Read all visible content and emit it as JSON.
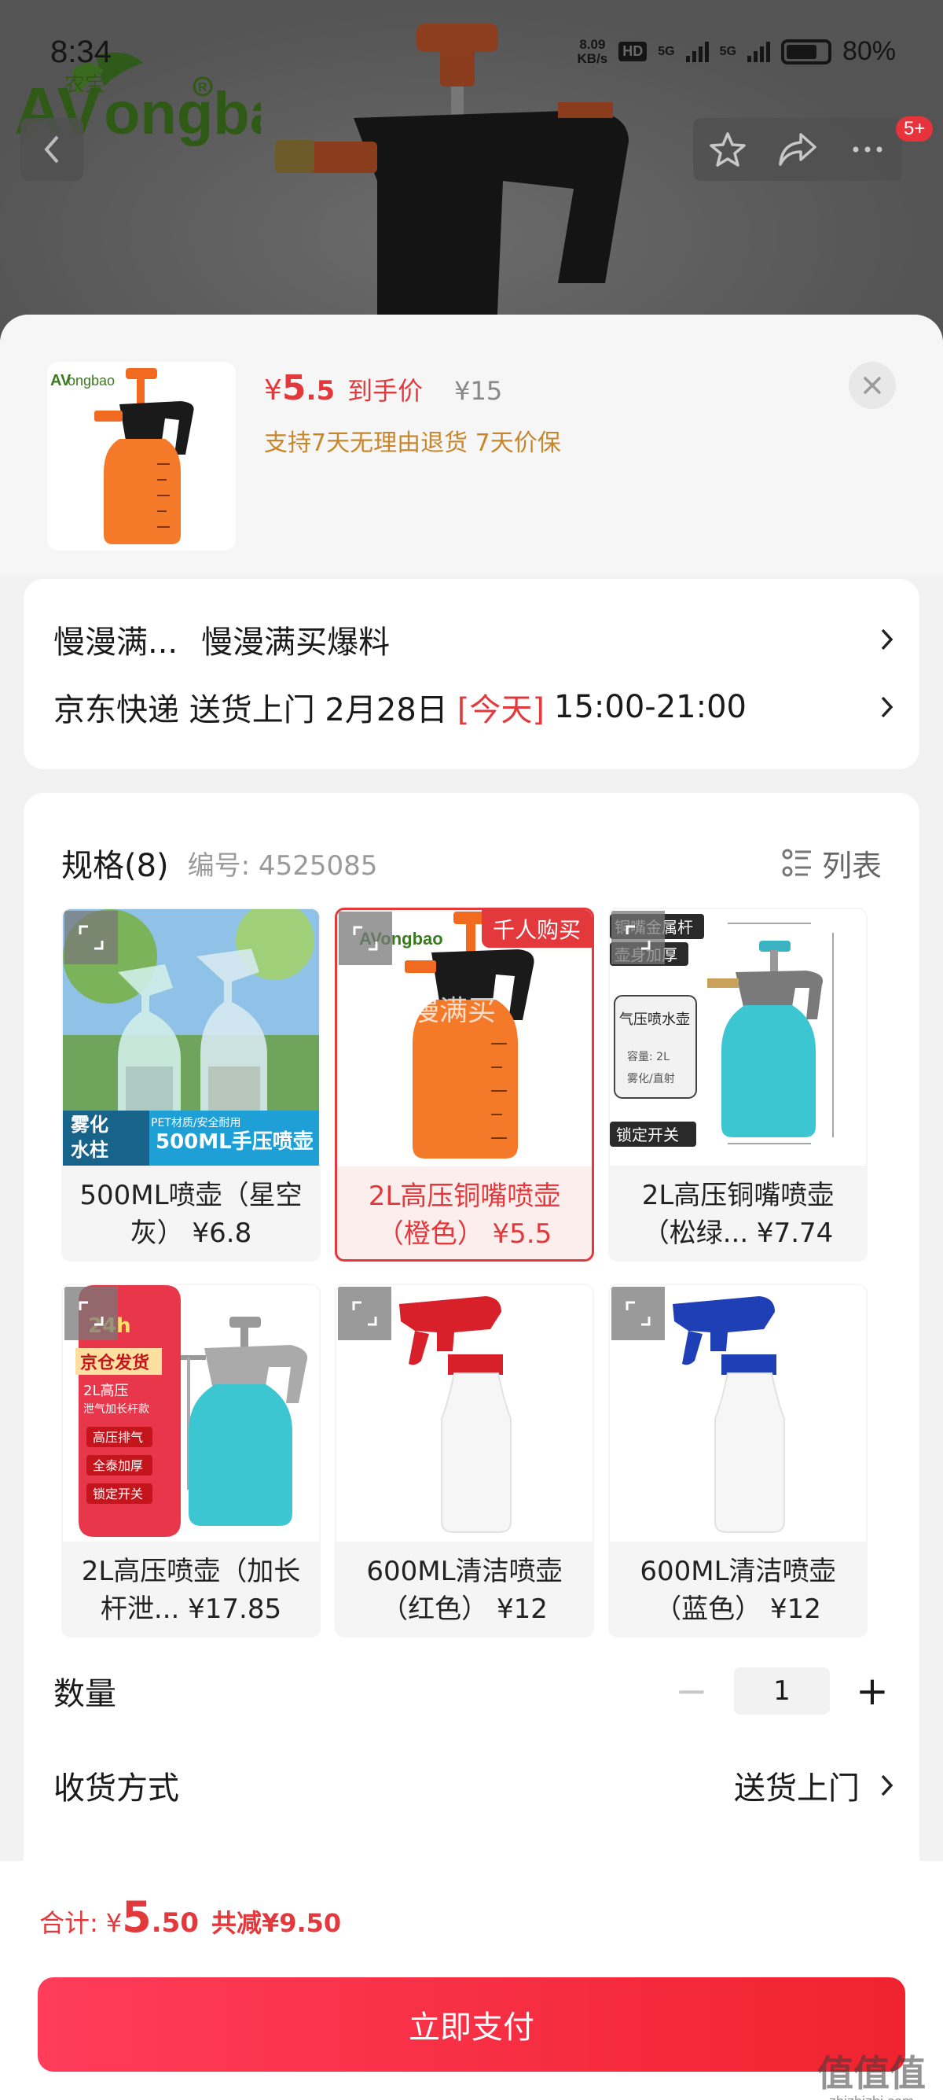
{
  "status_bar": {
    "time": "8:34",
    "net_speed": "8.09",
    "net_unit": "KB/s",
    "hd": "HD",
    "sig1": "5G",
    "sig2": "5G",
    "battery": "80%"
  },
  "brand": {
    "name": "Vongbao",
    "cn": "农宝"
  },
  "top_nav": {
    "more_badge": "5+"
  },
  "sheet": {
    "price_symbol": "¥",
    "price_int": "5",
    "price_dec": ".5",
    "price_label": "到手价",
    "original_price": "¥15",
    "promise": "支持7天无理由退货 7天价保"
  },
  "address": {
    "recipient": "慢漫满...",
    "detail": "慢漫满买爆料",
    "delivery_text": "京东快递 送货上门 2月28日",
    "today": "[今天]",
    "time_slot": "15:00-21:00"
  },
  "spec": {
    "title": "规格(8)",
    "code": "编号: 4525085",
    "list_label": "列表",
    "items": [
      {
        "name": "500ML喷壶（星空灰） ¥6.8",
        "img_text1": "雾化",
        "img_text2": "水柱",
        "img_text3": "500ML手压喷壶",
        "img_text4": "PET材质/安全耐用"
      },
      {
        "name": "2L高压铜嘴喷壶（橙色） ¥5.5",
        "tag": "千人购买",
        "overlay": "慢漫满买"
      },
      {
        "name": "2L高压铜嘴喷壶（松绿... ¥7.74",
        "img_a": "铜嘴金属杆",
        "img_b": "壶身加厚",
        "img_c": "气压喷水壶",
        "img_d": "容量: 2L",
        "img_e": "雾化/直射",
        "img_f": "锁定开关"
      },
      {
        "name": "2L高压喷壶（加长杆泄... ¥17.85",
        "img_a": "24h",
        "img_b": "京仓发货",
        "img_c": "2L高压",
        "img_d": "泄气加长杆款",
        "img_e": "高压排气",
        "img_f": "全泰加厚",
        "img_g": "锁定开关"
      },
      {
        "name": "600ML清洁喷壶（红色） ¥12"
      },
      {
        "name": "600ML清洁喷壶（蓝色） ¥12"
      }
    ]
  },
  "quantity": {
    "label": "数量",
    "minus": "−",
    "value": "1",
    "plus": "+"
  },
  "shipping": {
    "label": "收货方式",
    "value": "送货上门"
  },
  "footer": {
    "total_label": "合计:",
    "total_symbol": "¥",
    "total_int": "5",
    "total_dec": ".50",
    "saving": "共减¥9.50",
    "pay_label": "立即支付"
  },
  "watermark": {
    "text": "值值值",
    "sub": "zhizhizhi.com"
  },
  "colors": {
    "accent_red": "#e4393c",
    "promise_gold": "#c8862a",
    "pay_gradient_start": "#ff3c5a",
    "pay_gradient_end": "#f0232f"
  }
}
